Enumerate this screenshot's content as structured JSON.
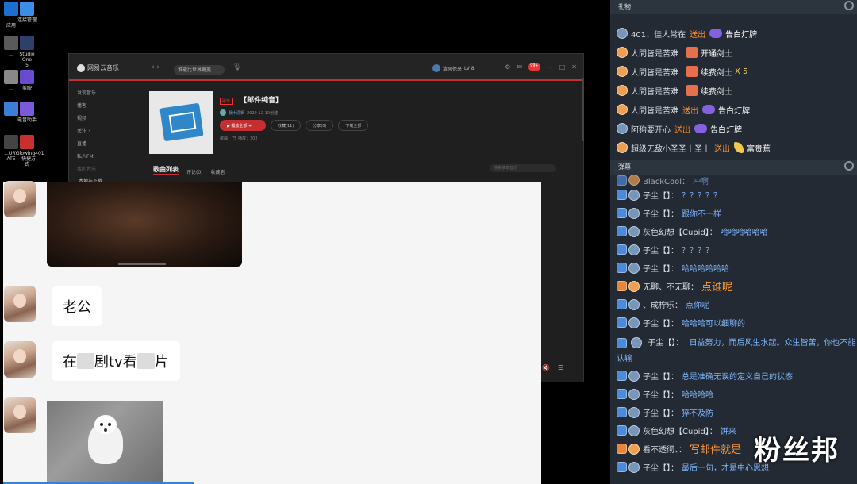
{
  "desktop": {
    "icons": [
      {
        "label": "...\n应用",
        "color": "#1c6fd1"
      },
      {
        "label": "连接管理",
        "color": "#3b8ee8"
      },
      {
        "label": "...",
        "color": "#5a5a5a"
      },
      {
        "label": "Studio One\n5",
        "color": "#2d3f6a"
      },
      {
        "label": "...",
        "color": "#888888"
      },
      {
        "label": "剪映",
        "color": "#6a4ad0"
      },
      {
        "label": "...",
        "color": "#3a7fd5"
      },
      {
        "label": "电音助手",
        "color": "#7a5ad8"
      },
      {
        "label": "...URY\nATE",
        "color": "#444444"
      },
      {
        "label": "Glowing401\n- 快捷方式",
        "color": "#c83030"
      }
    ]
  },
  "netease": {
    "app_name": "网易云音乐",
    "nav_arrows": "‹ ›",
    "search_text": "谁能比世界更美",
    "user_name": "清风徐来",
    "user_level": "LV 8",
    "notification_badge": "99+",
    "sidebar": [
      "发现音乐",
      "播客",
      "视频",
      "关注",
      "直播",
      "私人FM",
      "我的音乐",
      "本地与下载"
    ],
    "playlist_tag": "歌单",
    "playlist_name": "【邮件纯音】",
    "creator_name": "我十清枫",
    "created_date": "2020-12-10创建",
    "buttons": {
      "play_all": "▶ 播放全部",
      "add": "+",
      "collect": "收藏(11)",
      "share": "分享(0)",
      "download": "下载全部"
    },
    "meta": "歌曲：75    播放：302",
    "tabs": {
      "songs": "歌曲列表",
      "comments": "评论(0)",
      "collectors": "收藏者"
    },
    "filter_placeholder": "搜索歌单音乐",
    "window_controls": [
      "—",
      "□",
      "✕"
    ]
  },
  "chat": {
    "bubble1": "老公",
    "bubble2_prefix": "在",
    "bubble2_mid": "剧tv看",
    "bubble2_suffix": "片"
  },
  "panel": {
    "gift_header": "礼物",
    "danmu_header": "弹幕",
    "gifts": [
      {
        "badge": "grey",
        "user": "401、佳人常在",
        "action": "送出",
        "gift_icon": "car",
        "gift": "告白灯牌",
        "mult": ""
      },
      {
        "badge": "orange",
        "user": "人間皆是苦难",
        "action": "",
        "gift_icon": "box",
        "gift": "开通剑士",
        "mult": ""
      },
      {
        "badge": "orange",
        "user": "人間皆是苦难",
        "action": "",
        "gift_icon": "box",
        "gift": "续费剑士",
        "mult": "X 5"
      },
      {
        "badge": "orange",
        "user": "人間皆是苦难",
        "action": "",
        "gift_icon": "box",
        "gift": "续费剑士",
        "mult": ""
      },
      {
        "badge": "orange",
        "user": "人間皆是苦难",
        "action": "送出",
        "gift_icon": "car",
        "gift": "告白灯牌",
        "mult": ""
      },
      {
        "badge": "grey",
        "user": "阿狗要开心",
        "action": "送出",
        "gift_icon": "car",
        "gift": "告白灯牌",
        "mult": ""
      },
      {
        "badge": "orange",
        "user": "超级无敌小圣圣丨圣丨",
        "action": "送出",
        "gift_icon": "banana",
        "gift": "富贵蕉",
        "mult": ""
      }
    ],
    "danmu_top_user": "BlackCool：",
    "danmu_top_msg": "冲啊",
    "danmu": [
      {
        "lvl": "blue",
        "user": "子尘【】：",
        "msg": "？？？？？",
        "hl": false
      },
      {
        "lvl": "blue",
        "user": "子尘【】：",
        "msg": "跟你不一样",
        "hl": false
      },
      {
        "lvl": "blue",
        "user": "灰色幻想【Cupid】：",
        "msg": "哈哈哈哈哈哈",
        "hl": false
      },
      {
        "lvl": "blue",
        "user": "子尘【】：",
        "msg": "？？？？",
        "hl": false
      },
      {
        "lvl": "blue",
        "user": "子尘【】：",
        "msg": "哈哈哈哈哈哈",
        "hl": false
      },
      {
        "lvl": "orange",
        "user": "无聊、不无聊：",
        "msg": "点谁呢",
        "hl": true
      },
      {
        "lvl": "blue",
        "user": "、成柠乐：",
        "msg": "点你呢",
        "hl": false
      },
      {
        "lvl": "blue",
        "user": "子尘【】：",
        "msg": "哈哈哈可以细聊的",
        "hl": false
      }
    ],
    "danmu_wrap": {
      "user": "子尘【】：",
      "msg": "日益努力，而后风生水起。众生皆苦，你也不能认输"
    },
    "danmu2": [
      {
        "lvl": "blue",
        "user": "子尘【】：",
        "msg": "总是准确无误的定义自己的状态",
        "hl": false
      },
      {
        "lvl": "blue",
        "user": "子尘【】：",
        "msg": "哈哈哈哈",
        "hl": false
      },
      {
        "lvl": "blue",
        "user": "子尘【】：",
        "msg": "猝不及防",
        "hl": false
      },
      {
        "lvl": "blue",
        "user": "灰色幻想【Cupid】：",
        "msg": "饼来",
        "hl": false
      },
      {
        "lvl": "orange",
        "user": "看不透彻、：",
        "msg": "写邮件就是",
        "hl": true
      },
      {
        "lvl": "blue",
        "user": "子尘【】：",
        "msg": "最后一句，才是中心思想",
        "hl": false
      }
    ],
    "watermark": "粉丝邦"
  }
}
